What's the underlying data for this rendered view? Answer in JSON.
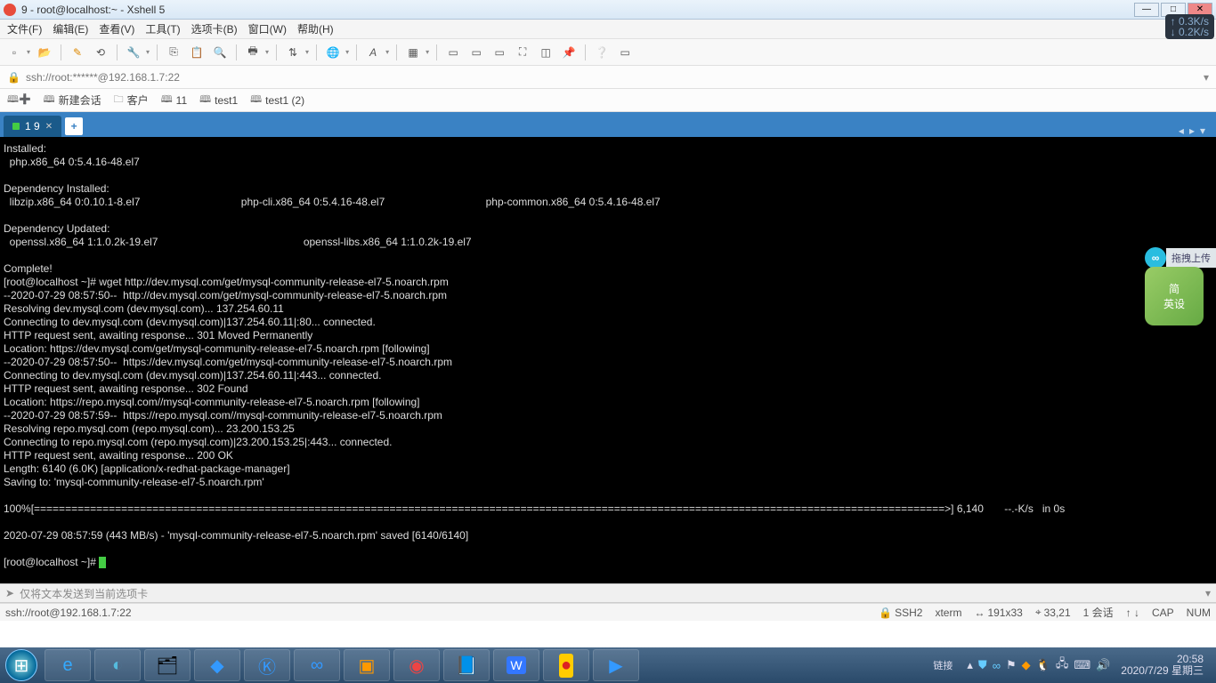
{
  "window": {
    "title": "9 - root@localhost:~ - Xshell 5",
    "speed_up": "↑ 0.3K/s",
    "speed_down": "↓ 0.2K/s"
  },
  "menu": {
    "file": "文件(F)",
    "edit": "编辑(E)",
    "view": "查看(V)",
    "tools": "工具(T)",
    "tabs": "选项卡(B)",
    "window": "窗口(W)",
    "help": "帮助(H)"
  },
  "address": {
    "url": "ssh://root:******@192.168.1.7:22"
  },
  "sessions": {
    "new": "新建会话",
    "guest": "客户",
    "s11": "11",
    "t1": "test1",
    "t2": "test1 (2)"
  },
  "tab": {
    "label": "1 9",
    "add": "+"
  },
  "terminal": {
    "content": "Installed:\n  php.x86_64 0:5.4.16-48.el7\n\nDependency Installed:\n  libzip.x86_64 0:0.10.1-8.el7                                  php-cli.x86_64 0:5.4.16-48.el7                                  php-common.x86_64 0:5.4.16-48.el7\n\nDependency Updated:\n  openssl.x86_64 1:1.0.2k-19.el7                                                 openssl-libs.x86_64 1:1.0.2k-19.el7\n\nComplete!\n[root@localhost ~]# wget http://dev.mysql.com/get/mysql-community-release-el7-5.noarch.rpm\n--2020-07-29 08:57:50--  http://dev.mysql.com/get/mysql-community-release-el7-5.noarch.rpm\nResolving dev.mysql.com (dev.mysql.com)... 137.254.60.11\nConnecting to dev.mysql.com (dev.mysql.com)|137.254.60.11|:80... connected.\nHTTP request sent, awaiting response... 301 Moved Permanently\nLocation: https://dev.mysql.com/get/mysql-community-release-el7-5.noarch.rpm [following]\n--2020-07-29 08:57:50--  https://dev.mysql.com/get/mysql-community-release-el7-5.noarch.rpm\nConnecting to dev.mysql.com (dev.mysql.com)|137.254.60.11|:443... connected.\nHTTP request sent, awaiting response... 302 Found\nLocation: https://repo.mysql.com//mysql-community-release-el7-5.noarch.rpm [following]\n--2020-07-29 08:57:59--  https://repo.mysql.com//mysql-community-release-el7-5.noarch.rpm\nResolving repo.mysql.com (repo.mysql.com)... 23.200.153.25\nConnecting to repo.mysql.com (repo.mysql.com)|23.200.153.25|:443... connected.\nHTTP request sent, awaiting response... 200 OK\nLength: 6140 (6.0K) [application/x-redhat-package-manager]\nSaving to: 'mysql-community-release-el7-5.noarch.rpm'\n\n100%[==================================================================================================================================================>] 6,140       --.-K/s   in 0s\n\n2020-07-29 08:57:59 (443 MB/s) - 'mysql-community-release-el7-5.noarch.rpm' saved [6140/6140]\n\n[root@localhost ~]# "
  },
  "float": {
    "upload": "拖拽上传",
    "app1": "简",
    "app2": "英设"
  },
  "sendbar": {
    "text": "仅将文本发送到当前选项卡"
  },
  "status": {
    "left": "ssh://root@192.168.1.7:22",
    "proto": "SSH2",
    "term": "xterm",
    "size": "191x33",
    "cursor": "33,21",
    "sess": "1 会话",
    "cap": "CAP",
    "num": "NUM"
  },
  "taskbar": {
    "link": "链接",
    "time": "20:58",
    "date": "2020/7/29 星期三"
  }
}
